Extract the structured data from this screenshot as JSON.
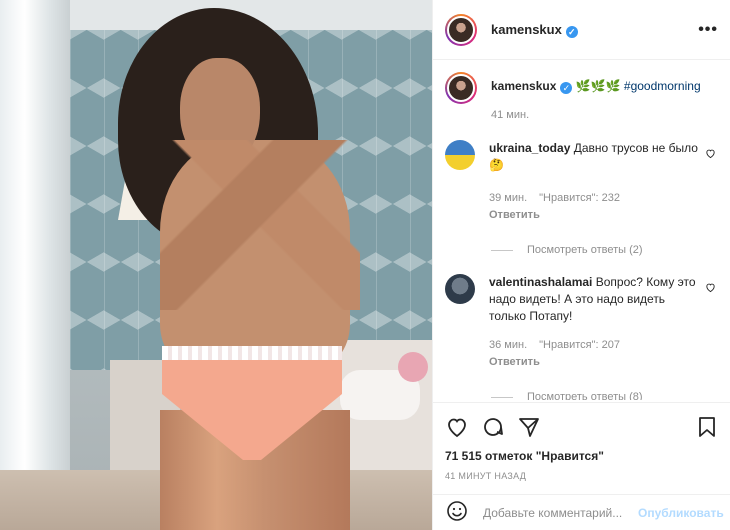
{
  "post": {
    "image_alt": "",
    "author": "kamenskux",
    "verified": true,
    "caption_emojis": "🌿🌿🌿",
    "caption_tag": "#goodmorning",
    "caption_time": "41 мин."
  },
  "comments": [
    {
      "user": "ukraina_today",
      "text": "Давно трусов не было 🤔",
      "time": "39 мин.",
      "likes": "\"Нравится\": 232",
      "reply": "Ответить",
      "view_replies": "Посмотреть ответы (2)"
    },
    {
      "user": "valentinashalamai",
      "text": "Вопрос? Кому это надо видеть! А это надо видеть только Потапу!",
      "time": "36 мин.",
      "likes": "\"Нравится\": 207",
      "reply": "Ответить",
      "view_replies": "Посмотреть ответы (8)"
    }
  ],
  "actions": {
    "likes_count": "71 515 отметок \"Нравится\"",
    "time_ago": "41 МИНУТ НАЗАД"
  },
  "add_comment": {
    "placeholder": "Добавьте комментарий...",
    "post_label": "Опубликовать"
  },
  "header": {
    "more_label": "•••"
  },
  "icons": {
    "verified": "verified-icon",
    "like": "heart-icon",
    "comment": "comment-icon",
    "share": "paper-plane-icon",
    "save": "bookmark-icon",
    "emoji": "emoji-icon"
  },
  "colors": {
    "verified": "#3897f0",
    "post_button_disabled": "#b3dbff",
    "muted_text": "#8e8e8e"
  }
}
